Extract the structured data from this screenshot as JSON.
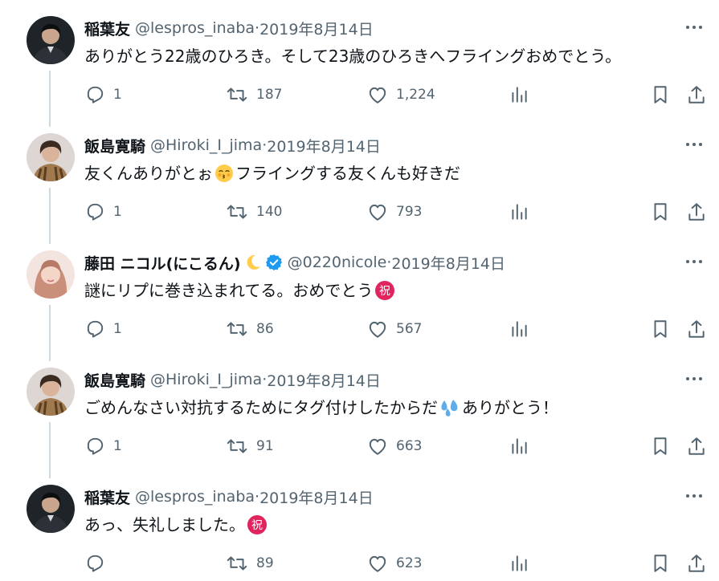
{
  "tweets": [
    {
      "name": "稲葉友",
      "handle": "@lespros_inaba",
      "date": "2019年8月14日",
      "text": "ありがとう22歳のひろき。そして23歳のひろきへフライングおめでとう。",
      "replies": "1",
      "retweets": "187",
      "likes": "1,224"
    },
    {
      "name": "飯島寛騎",
      "handle": "@Hiroki_I_jima",
      "date": "2019年8月14日",
      "text_before": "友くんありがとぉ",
      "text_after": "フライングする友くんも好きだ",
      "replies": "1",
      "retweets": "140",
      "likes": "793"
    },
    {
      "name": "藤田 ニコル(にこるん)",
      "handle": "@0220nicole",
      "date": "2019年8月14日",
      "text": "謎にリプに巻き込まれてる。おめでとう",
      "replies": "1",
      "retweets": "86",
      "likes": "567"
    },
    {
      "name": "飯島寛騎",
      "handle": "@Hiroki_I_jima",
      "date": "2019年8月14日",
      "text_before": "ごめんなさい対抗するためにタグ付けしたからだ",
      "text_after": "ありがとう！",
      "replies": "1",
      "retweets": "91",
      "likes": "663"
    },
    {
      "name": "稲葉友",
      "handle": "@lespros_inaba",
      "date": "2019年8月14日",
      "text": "あっ、失礼しました。",
      "retweets": "89",
      "likes": "623"
    }
  ],
  "separator": " · ",
  "emoji": {
    "celebrate": "祝"
  },
  "icons": {
    "more": "more-icon",
    "reply": "reply-icon",
    "retweet": "retweet-icon",
    "like": "heart-icon",
    "views": "views-icon",
    "bookmark": "bookmark-icon",
    "share": "share-icon",
    "verified": "verified-badge-icon",
    "moon": "crescent-moon-icon"
  },
  "colors": {
    "text": "#0f1419",
    "secondary": "#536471",
    "thread_line": "#cfd9de",
    "verified": "#1d9bf0",
    "celebrate": "#e0245e"
  }
}
